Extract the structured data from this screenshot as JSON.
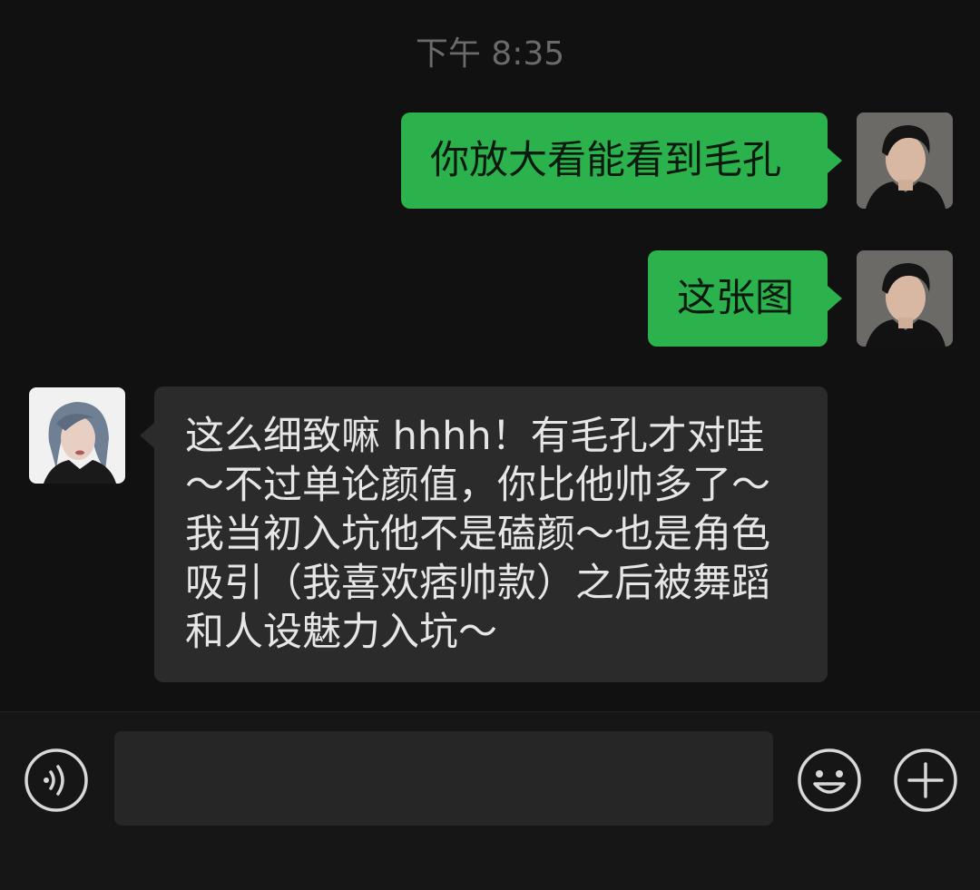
{
  "chat": {
    "timestamp": "下午 8:35",
    "messages": [
      {
        "sender": "me",
        "text": "你放大看能看到毛孔"
      },
      {
        "sender": "me",
        "text": "这张图"
      },
      {
        "sender": "them",
        "text": "这么细致嘛 hhhh！有毛孔才对哇～不过单论颜值，你比他帅多了～我当初入坑他不是磕颜～也是角色吸引（我喜欢痞帅款）之后被舞蹈和人设魅力入坑～"
      }
    ]
  },
  "input_bar": {
    "voice_icon": "voice-icon",
    "emoji_icon": "emoji-icon",
    "add_icon": "plus-icon",
    "input_value": ""
  },
  "colors": {
    "background": "#111111",
    "my_bubble": "#2bb24c",
    "their_bubble": "#2b2b2b"
  }
}
